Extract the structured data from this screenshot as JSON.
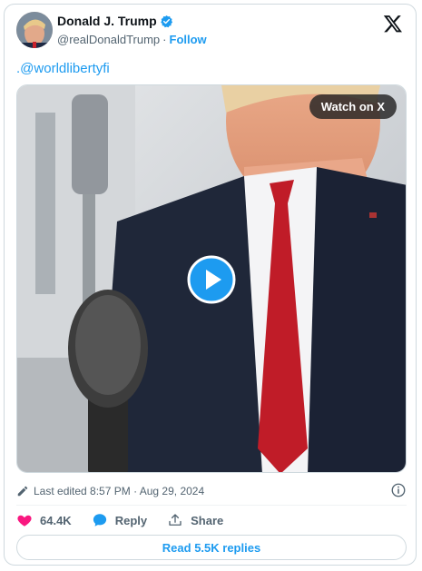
{
  "author": {
    "name": "Donald J. Trump",
    "handle": "@realDonaldTrump",
    "separator": "·",
    "follow_label": "Follow"
  },
  "tweet": {
    "text": ".@worldlibertyfi"
  },
  "media": {
    "watch_label": "Watch on X",
    "play_icon": "play-icon"
  },
  "meta": {
    "edited_text": "Last edited 8:57 PM · Aug 29, 2024"
  },
  "actions": {
    "like_count": "64.4K",
    "reply_label": "Reply",
    "share_label": "Share"
  },
  "read_replies_label": "Read 5.5K replies",
  "colors": {
    "accent": "#1d9bf0",
    "like": "#f91880",
    "muted": "#536471",
    "border": "#cfd9de"
  }
}
